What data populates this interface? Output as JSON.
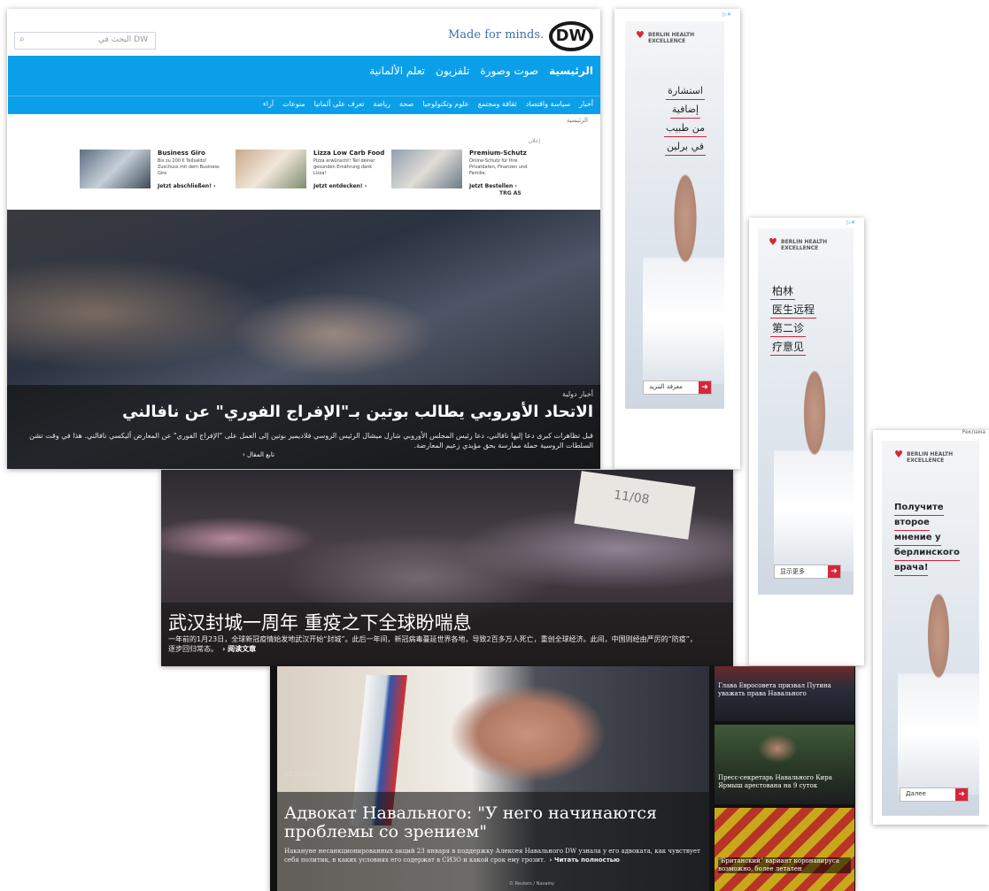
{
  "arabic_site": {
    "search_placeholder": "البحث في DW",
    "tagline": "Made for minds.",
    "logo": "DW",
    "nav_top": [
      "الرئيسية",
      "صوت وصورة",
      "تلفزيون",
      "تعلم الألمانية"
    ],
    "nav_sub": [
      "أخبار",
      "سياسة واقتصاد",
      "ثقافة ومجتمع",
      "علوم وتكنولوجيا",
      "صحة",
      "رياضة",
      "تعرف على ألمانيا",
      "منوعات",
      "آراء"
    ],
    "breadcrumb": "الرئيسية",
    "ads_label": "إعلان",
    "ads": [
      {
        "title": "Premium-Schutz",
        "text": "Online-Schutz für Ihre Privatdaten, Finanzen und Familie.",
        "cta": "Jetzt Bestellen ›"
      },
      {
        "title": "Lizza Low Carb Food",
        "text": "Pizza erwünscht! Teil deiner gesunden Ernährung dank Lizza!",
        "cta": "Jetzt entdecken! ›"
      },
      {
        "title": "Business Giro",
        "text": "Bis zu 200 € Teilsaldo! Zuschuss mit dem Business Giro",
        "cta": "Jetzt abschließen! ›"
      }
    ],
    "ad_footer": "TRG AS",
    "hero": {
      "category": "أخبار دولية",
      "headline": "الاتحاد الأوروبي يطالب بوتين بـ\"الإفراج الفوري\" عن نافالني",
      "description": "قبل تظاهرات كبرى دعا إليها نافالني، دعا رئيس المجلس الأوروبي شارل ميشال الرئيس الروسي فلاديمير بوتين إلى العمل على \"الإفراج الفوري\" عن المعارض أليكسي نافالني. هذا في وقت تشن السلطات الروسية حملة ممارسة بحق مؤيدي زعيم المعارضة.",
      "more": "› تابع المقال"
    }
  },
  "ad_arabic": {
    "brand": "BERLIN HEALTH EXCELLENCE",
    "lines": [
      "استشارة",
      "إضافية",
      "من طبيب",
      "في برلين"
    ],
    "button": "معرفة المزيد"
  },
  "ad_chinese": {
    "brand": "BERLIN HEALTH EXCELLENCE",
    "lines": [
      "柏林",
      "医生远程",
      "第二诊",
      "疗意见"
    ],
    "button": "显示更多"
  },
  "ad_russian": {
    "label": "Реклама",
    "brand": "BERLIN HEALTH EXCELLENCE",
    "lines": [
      "Получите",
      "второе",
      "мнение у",
      "берлинского",
      "врача!"
    ],
    "button": "Далее"
  },
  "chinese_site": {
    "sign_text": "11/08",
    "headline": "武汉封城一周年 重疫之下全球盼喘息",
    "description": "一年前的1月23日，全球新冠疫情始发地武汉开始“封城”。此后一年间，新冠病毒蔓延世界各地，导致2百多万人死亡，重创全球经济。此间，中国则经由严厉的“防疫”，逐步回归常态。",
    "more": "› 阅读文章"
  },
  "russian_site": {
    "date": "22.01.2021",
    "headline": "Адвокат Навального: \"У него начинаются проблемы со зрением\"",
    "description": "Накануне несанкционированных акций 23 января в поддержку Алексея Навального DW узнала у его адвоката, как чувствует себя политик, в каких условиях его содержат в СИЗО и какой срок ему грозит.",
    "more": "› Читать полностью",
    "photo_credit": "© Reuters / Navalny",
    "side": [
      {
        "title": "Глава Евросовета призвал Путина уважать права Навального"
      },
      {
        "title": "Пресс-секретарь Навального Кира Ярмыш арестована на 9 суток"
      },
      {
        "title": "\"Британский\" вариант коронавируса возможно, более летален"
      }
    ]
  }
}
